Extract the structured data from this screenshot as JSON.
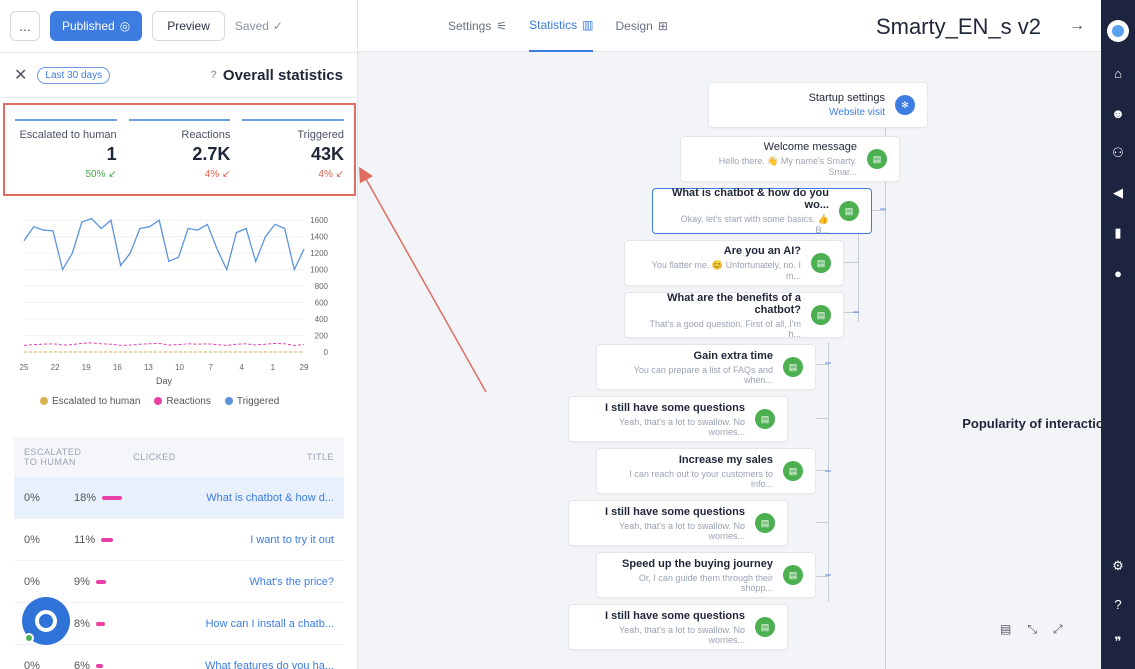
{
  "app": {
    "title": "Smarty_EN_s v2"
  },
  "toolbar": {
    "more": "...",
    "published": "Published",
    "preview": "Preview",
    "saved": "Saved"
  },
  "tabs": [
    {
      "label": "Design",
      "icon": "design-icon"
    },
    {
      "label": "Statistics",
      "icon": "bar-chart-icon"
    },
    {
      "label": "Settings",
      "icon": "sliders-icon"
    }
  ],
  "stats": {
    "title": "Overall statistics",
    "range": "Last 30 days",
    "kpis": [
      {
        "label": "Triggered",
        "value": "43K",
        "delta": "4%",
        "direction": "down"
      },
      {
        "label": "Reactions",
        "value": "2.7K",
        "delta": "4%",
        "direction": "down"
      },
      {
        "label": "Escalated to human",
        "value": "1",
        "delta": "50%",
        "direction": "up"
      }
    ]
  },
  "chart_data": {
    "type": "line",
    "xlabel": "Day",
    "x_ticks": [
      29,
      1,
      4,
      7,
      10,
      13,
      16,
      19,
      22,
      25
    ],
    "y_ticks": [
      0,
      200,
      400,
      600,
      800,
      1000,
      1200,
      1400,
      1600
    ],
    "ylim": [
      0,
      1700
    ],
    "series": [
      {
        "name": "Triggered",
        "color": "#5b93dc",
        "values": [
          1350,
          1520,
          1480,
          1470,
          1000,
          1200,
          1580,
          1620,
          1500,
          1600,
          1050,
          1200,
          1500,
          1520,
          1600,
          1100,
          1150,
          1500,
          1480,
          1550,
          1250,
          1000,
          1450,
          1500,
          1100,
          1400,
          1550,
          1500,
          1000,
          1250
        ]
      },
      {
        "name": "Reactions",
        "color": "#e93fa7",
        "values": [
          80,
          90,
          95,
          100,
          85,
          90,
          105,
          110,
          100,
          95,
          80,
          85,
          95,
          100,
          105,
          85,
          90,
          100,
          95,
          100,
          90,
          80,
          95,
          100,
          85,
          95,
          105,
          100,
          80,
          90
        ]
      },
      {
        "name": "Escalated to human",
        "color": "#d7b24c",
        "values": [
          0,
          0,
          0,
          1,
          0,
          0,
          0,
          0,
          0,
          0,
          0,
          0,
          0,
          0,
          0,
          0,
          0,
          0,
          0,
          0,
          0,
          0,
          0,
          0,
          0,
          0,
          0,
          0,
          0,
          0
        ]
      }
    ],
    "legend": [
      "Triggered",
      "Reactions",
      "Escalated to human"
    ]
  },
  "popularity": {
    "title": "Popularity of interactions",
    "headers": {
      "title": "TITLE",
      "clicked": "CLICKED",
      "escalated": "ESCALATED TO HUMAN"
    },
    "rows": [
      {
        "title": "What is chatbot & how d...",
        "clicked": "18%",
        "escalated": "0%",
        "bar": 0.18
      },
      {
        "title": "I want to try it out",
        "clicked": "11%",
        "escalated": "0%",
        "bar": 0.11
      },
      {
        "title": "What's the price?",
        "clicked": "9%",
        "escalated": "0%",
        "bar": 0.09
      },
      {
        "title": "How can I install a chatb...",
        "clicked": "8%",
        "escalated": "",
        "bar": 0.08
      },
      {
        "title": "What features do you ha...",
        "clicked": "6%",
        "escalated": "0%",
        "bar": 0.06
      }
    ]
  },
  "flow": {
    "start": {
      "title": "Startup settings",
      "link": "Website visit"
    },
    "nodes": [
      {
        "title": "Welcome message",
        "sub": "Hello there. 👋 My name's Smarty. Smar..."
      },
      {
        "title": "What is chatbot & how do you wo...",
        "sub": "Okay, let's start with some basics. 👍 B..."
      },
      {
        "title": "Are you an AI?",
        "sub": "You flatter me. 😊 Unfortunately, no. I m..."
      },
      {
        "title": "What are the benefits of a chatbot?",
        "sub": "That's a good question. First of all, I'm h..."
      },
      {
        "title": "Gain extra time",
        "sub": "You can prepare a list of FAQs and when..."
      },
      {
        "title": "I still have some questions",
        "sub": "Yeah, that's a lot to swallow. No worries..."
      },
      {
        "title": "Increase my sales",
        "sub": "I can reach out to your customers to info..."
      },
      {
        "title": "I still have some questions",
        "sub": "Yeah, that's a lot to swallow. No worries..."
      },
      {
        "title": "Speed up the buying journey",
        "sub": "Or, I can guide them through their shopp..."
      },
      {
        "title": "I still have some questions",
        "sub": "Yeah, that's a lot to swallow. No worries..."
      }
    ]
  }
}
